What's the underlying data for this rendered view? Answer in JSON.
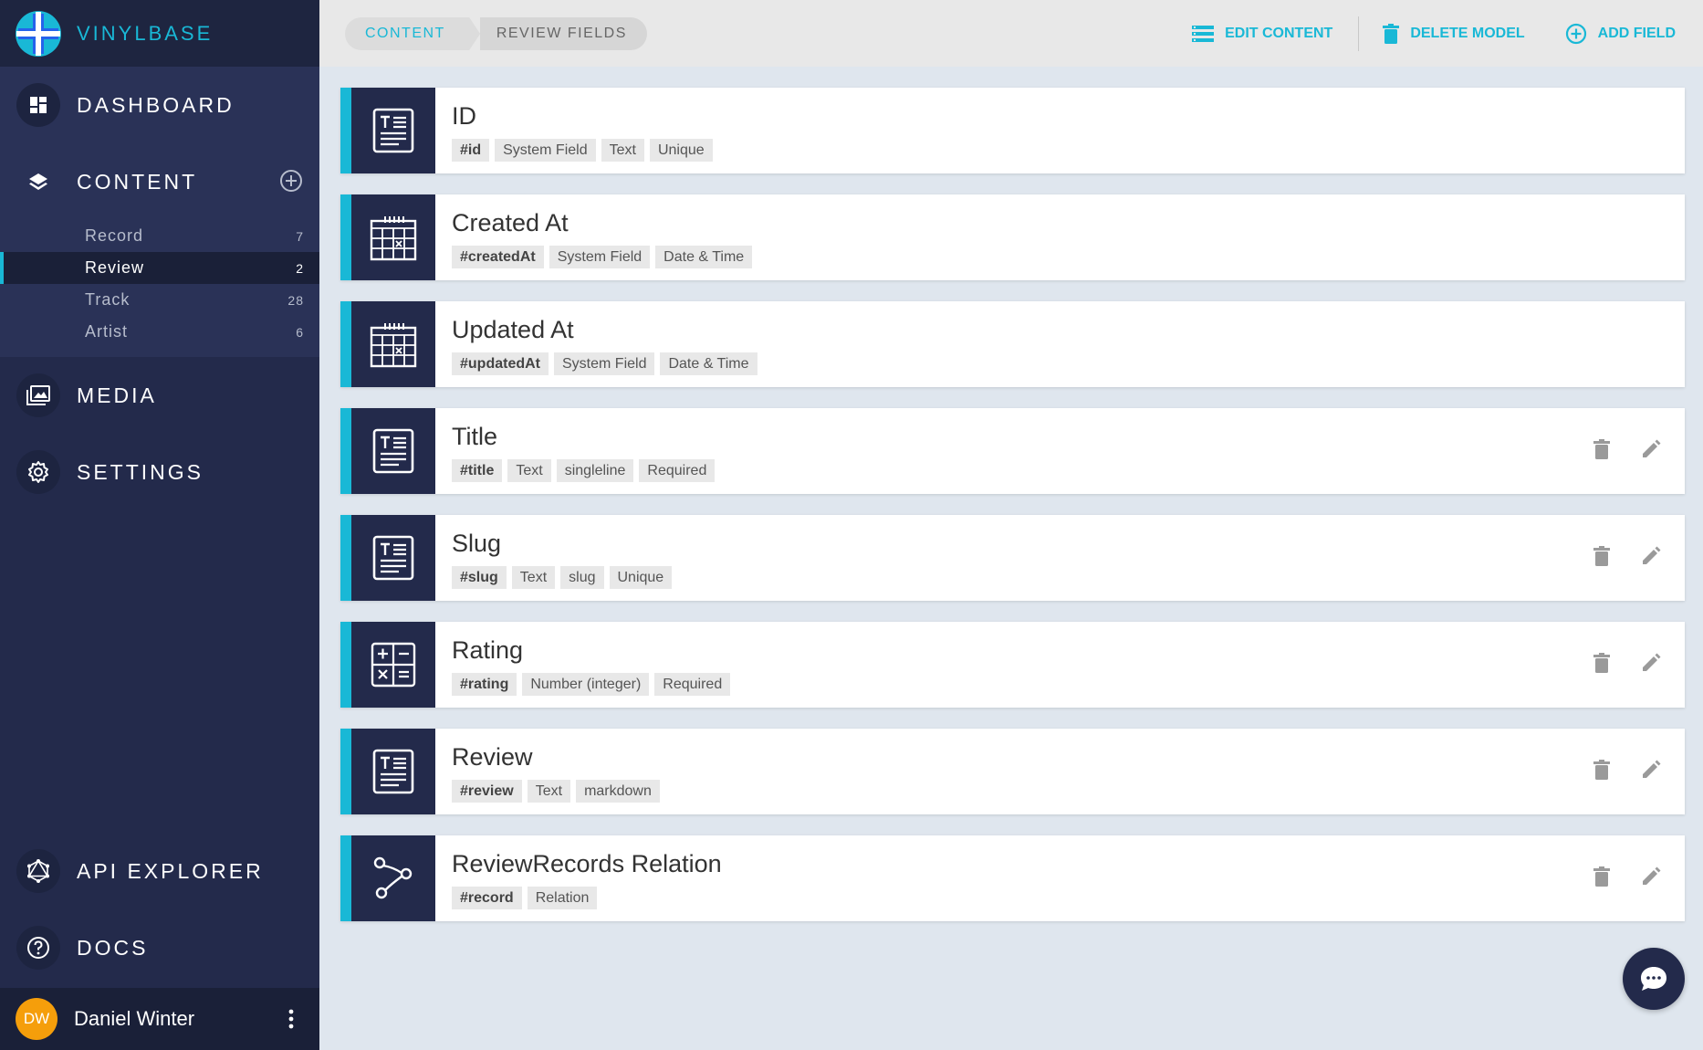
{
  "app": {
    "name": "VINYLBASE"
  },
  "nav": {
    "dashboard": "DASHBOARD",
    "content": "CONTENT",
    "media": "MEDIA",
    "settings": "SETTINGS",
    "api_explorer": "API EXPLORER",
    "docs": "DOCS"
  },
  "models": [
    {
      "label": "Record",
      "count": "7",
      "active": false
    },
    {
      "label": "Review",
      "count": "2",
      "active": true
    },
    {
      "label": "Track",
      "count": "28",
      "active": false
    },
    {
      "label": "Artist",
      "count": "6",
      "active": false
    }
  ],
  "user": {
    "initials": "DW",
    "name": "Daniel Winter"
  },
  "breadcrumb": {
    "first": "CONTENT",
    "second": "REVIEW FIELDS"
  },
  "actions": {
    "edit": "EDIT CONTENT",
    "delete": "DELETE MODEL",
    "add": "ADD FIELD"
  },
  "fields": [
    {
      "name": "ID",
      "icon": "text-field-icon",
      "tags": [
        "#id",
        "System Field",
        "Text",
        "Unique"
      ],
      "editable": false
    },
    {
      "name": "Created At",
      "icon": "calendar-icon",
      "tags": [
        "#createdAt",
        "System Field",
        "Date & Time"
      ],
      "editable": false
    },
    {
      "name": "Updated At",
      "icon": "calendar-icon",
      "tags": [
        "#updatedAt",
        "System Field",
        "Date & Time"
      ],
      "editable": false
    },
    {
      "name": "Title",
      "icon": "text-field-icon",
      "tags": [
        "#title",
        "Text",
        "singleline",
        "Required"
      ],
      "editable": true
    },
    {
      "name": "Slug",
      "icon": "text-field-icon",
      "tags": [
        "#slug",
        "Text",
        "slug",
        "Unique"
      ],
      "editable": true
    },
    {
      "name": "Rating",
      "icon": "calculator-icon",
      "tags": [
        "#rating",
        "Number (integer)",
        "Required"
      ],
      "editable": true
    },
    {
      "name": "Review",
      "icon": "text-field-icon",
      "tags": [
        "#review",
        "Text",
        "markdown"
      ],
      "editable": true
    },
    {
      "name": "ReviewRecords Relation",
      "icon": "relation-icon",
      "tags": [
        "#record",
        "Relation"
      ],
      "editable": true
    }
  ],
  "colors": {
    "accent": "#19b8d6",
    "sidebar": "#232a4b",
    "background": "#dfe6ee",
    "avatar": "#f59e0b"
  }
}
